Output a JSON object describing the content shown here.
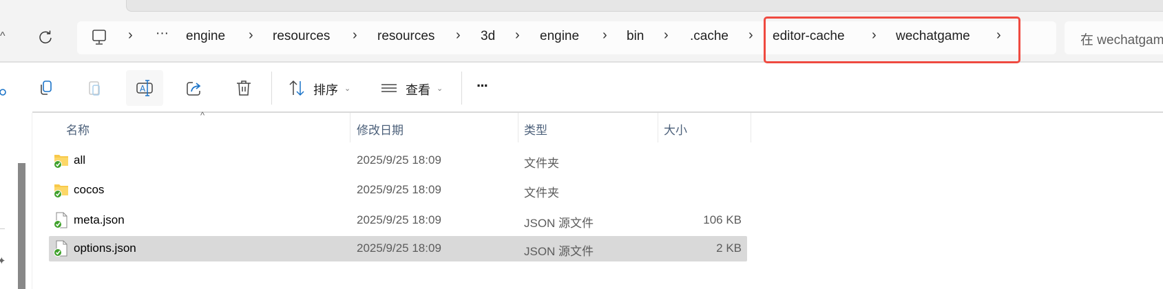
{
  "address_bar": {
    "crumbs": [
      "engine",
      "resources",
      "resources",
      "3d",
      "engine",
      "bin",
      ".cache",
      "editor-cache",
      "wechatgame"
    ],
    "overflow": "···",
    "separator": "›"
  },
  "search": {
    "placeholder": "在 wechatgame"
  },
  "highlight_color": "#ef4a40",
  "toolbar": {
    "sort_label": "排序",
    "view_label": "查看",
    "more_label": "···"
  },
  "columns": {
    "name": "名称",
    "date": "修改日期",
    "type": "类型",
    "size": "大小"
  },
  "files": [
    {
      "name": "all",
      "date": "2025/9/25 18:09",
      "type": "文件夹",
      "size": "",
      "icon": "folder-synced"
    },
    {
      "name": "cocos",
      "date": "2025/9/25 18:09",
      "type": "文件夹",
      "size": "",
      "icon": "folder-synced"
    },
    {
      "name": "meta.json",
      "date": "2025/9/25 18:09",
      "type": "JSON 源文件",
      "size": "106 KB",
      "icon": "file-synced"
    },
    {
      "name": "options.json",
      "date": "2025/9/25 18:09",
      "type": "JSON 源文件",
      "size": "2 KB",
      "icon": "file-synced",
      "selected": true
    }
  ]
}
